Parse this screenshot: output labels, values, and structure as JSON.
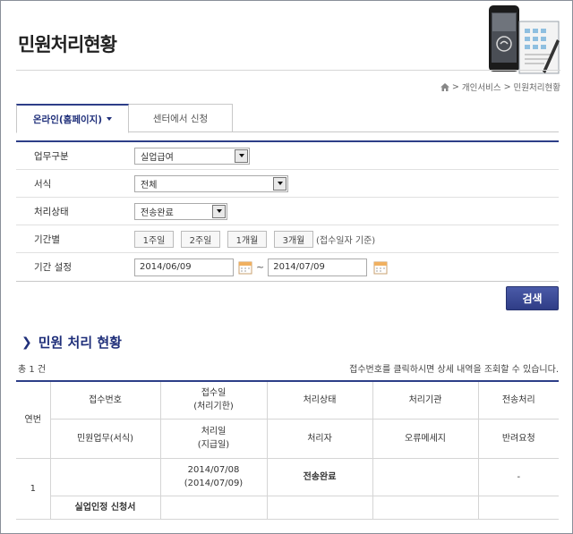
{
  "page": {
    "title": "민원처리현황"
  },
  "breadcrumb": [
    "개인서비스",
    "민원처리현황"
  ],
  "tabs": [
    {
      "label": "온라인(홈페이지)",
      "active": true
    },
    {
      "label": "센터에서 신청",
      "active": false
    }
  ],
  "form": {
    "category": {
      "label": "업무구분",
      "value": "실업급여"
    },
    "format": {
      "label": "서식",
      "value": "전체"
    },
    "status": {
      "label": "처리상태",
      "value": "전송완료"
    },
    "period": {
      "label": "기간별",
      "buttons": [
        "1주일",
        "2주일",
        "1개월",
        "3개월"
      ],
      "note": "(접수일자 기준)"
    },
    "range": {
      "label": "기간 설정",
      "from": "2014/06/09",
      "to": "2014/07/09",
      "separator": "~"
    }
  },
  "search_button": "검색",
  "section": {
    "title": "민원 처리 현황",
    "total": "총 1 건",
    "hint": "접수번호를 클릭하시면 상세 내역을 조회할 수 있습니다."
  },
  "table": {
    "col_no": "연번",
    "header1": [
      "접수번호",
      "접수일",
      "(처리기한)",
      "처리상태",
      "처리기관",
      "전송처리"
    ],
    "header2": [
      "민원업무(서식)",
      "처리일",
      "(지급일)",
      "처리자",
      "오류메세지",
      "반려요청"
    ],
    "rows": [
      {
        "no": "1",
        "receipt_no": "",
        "date": "2014/07/08",
        "deadline": "(2014/07/09)",
        "status": "전송완료",
        "agency": "",
        "transfer": "-",
        "task": "실업인정 신청서"
      }
    ]
  },
  "colors": {
    "accent": "#2d3e88",
    "title_blue": "#1f2f7a"
  }
}
